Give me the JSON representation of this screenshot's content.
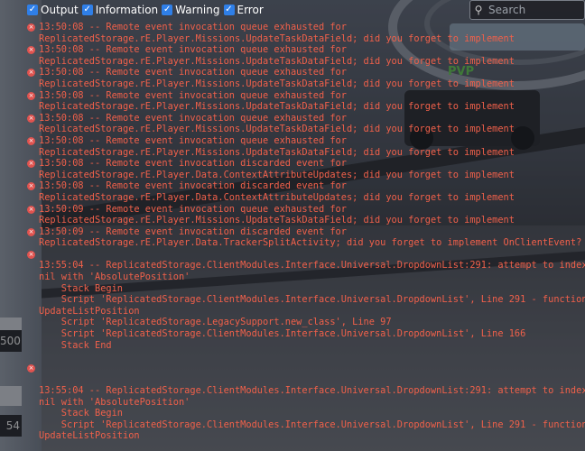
{
  "game": {
    "pvp_label": "PVP",
    "side_values": [
      "500",
      "54"
    ]
  },
  "filters": [
    {
      "label": "Output",
      "checked": true
    },
    {
      "label": "Information",
      "checked": true
    },
    {
      "label": "Warning",
      "checked": true
    },
    {
      "label": "Error",
      "checked": true
    }
  ],
  "search": {
    "placeholder": "Search"
  },
  "log": {
    "entries": [
      {
        "type": "error",
        "lines": [
          "13:50:08 -- Remote event invocation queue exhausted for",
          "ReplicatedStorage.rE.Player.Missions.UpdateTaskDataField; did you forget to implement"
        ]
      },
      {
        "type": "error",
        "lines": [
          "13:50:08 -- Remote event invocation queue exhausted for",
          "ReplicatedStorage.rE.Player.Missions.UpdateTaskDataField; did you forget to implement"
        ]
      },
      {
        "type": "error",
        "lines": [
          "13:50:08 -- Remote event invocation queue exhausted for",
          "ReplicatedStorage.rE.Player.Missions.UpdateTaskDataField; did you forget to implement"
        ]
      },
      {
        "type": "error",
        "lines": [
          "13:50:08 -- Remote event invocation queue exhausted for",
          "ReplicatedStorage.rE.Player.Missions.UpdateTaskDataField; did you forget to implement"
        ]
      },
      {
        "type": "error",
        "lines": [
          "13:50:08 -- Remote event invocation queue exhausted for",
          "ReplicatedStorage.rE.Player.Missions.UpdateTaskDataField; did you forget to implement"
        ]
      },
      {
        "type": "error",
        "lines": [
          "13:50:08 -- Remote event invocation queue exhausted for",
          "ReplicatedStorage.rE.Player.Missions.UpdateTaskDataField; did you forget to implement"
        ]
      },
      {
        "type": "error",
        "lines": [
          "13:50:08 -- Remote event invocation discarded event for",
          "ReplicatedStorage.rE.Player.Data.ContextAttributeUpdates; did you forget to implement"
        ]
      },
      {
        "type": "error",
        "lines": [
          "13:50:08 -- Remote event invocation discarded event for",
          "ReplicatedStorage.rE.Player.Data.ContextAttributeUpdates; did you forget to implement"
        ]
      },
      {
        "type": "error",
        "lines": [
          "13:50:09 -- Remote event invocation queue exhausted for",
          "ReplicatedStorage.rE.Player.Missions.UpdateTaskDataField; did you forget to implement"
        ]
      },
      {
        "type": "error",
        "lines": [
          "13:50:09 -- Remote event invocation discarded event for",
          "ReplicatedStorage.rE.Player.Data.TrackerSplitActivity; did you forget to implement OnClientEvent?"
        ]
      },
      {
        "type": "error",
        "lines": [
          "",
          "13:55:04 -- ReplicatedStorage.ClientModules.Interface.Universal.DropdownList:291: attempt to index",
          "nil with 'AbsolutePosition'",
          "    Stack Begin",
          "    Script 'ReplicatedStorage.ClientModules.Interface.Universal.DropdownList', Line 291 - function",
          "UpdateListPosition",
          "    Script 'ReplicatedStorage.LegacySupport.new_class', Line 97",
          "    Script 'ReplicatedStorage.ClientModules.Interface.Universal.DropdownList', Line 166",
          "    Stack End",
          ""
        ]
      },
      {
        "type": "error",
        "lines": [
          "",
          "",
          "13:55:04 -- ReplicatedStorage.ClientModules.Interface.Universal.DropdownList:291: attempt to index",
          "nil with 'AbsolutePosition'",
          "    Stack Begin",
          "    Script 'ReplicatedStorage.ClientModules.Interface.Universal.DropdownList', Line 291 - function",
          "UpdateListPosition"
        ]
      }
    ]
  }
}
